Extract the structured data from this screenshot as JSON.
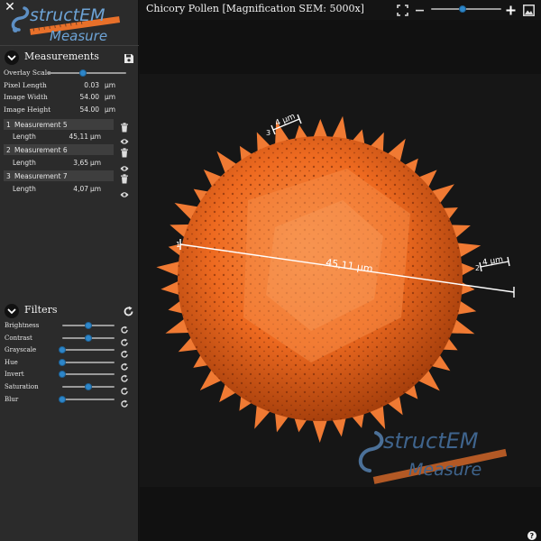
{
  "app": {
    "logo_top": "structEM",
    "logo_bottom": "Measure"
  },
  "image_title": "Chicory Pollen [Magnification SEM: 5000x]",
  "measurements_section": {
    "title": "Measurements",
    "overlay_scale": {
      "label": "Overlay Scale",
      "value": 0.45
    },
    "fields": [
      {
        "label": "Pixel Length",
        "value": "0.03",
        "unit": "µm"
      },
      {
        "label": "Image Width",
        "value": "54.00",
        "unit": "µm"
      },
      {
        "label": "Image Height",
        "value": "54.00",
        "unit": "µm"
      }
    ],
    "items": [
      {
        "index": "1",
        "name": "Measurement 5",
        "length_label": "Length",
        "value": "45,11",
        "unit": "µm"
      },
      {
        "index": "2",
        "name": "Measurement 6",
        "length_label": "Length",
        "value": "3,65",
        "unit": "µm"
      },
      {
        "index": "3",
        "name": "Measurement 7",
        "length_label": "Length",
        "value": "4,07",
        "unit": "µm"
      }
    ]
  },
  "filters_section": {
    "title": "Filters",
    "filters": [
      {
        "label": "Brightness",
        "value": 0.5
      },
      {
        "label": "Contrast",
        "value": 0.5
      },
      {
        "label": "Grayscale",
        "value": 0.0
      },
      {
        "label": "Hue",
        "value": 0.0
      },
      {
        "label": "Invert",
        "value": 0.0
      },
      {
        "label": "Saturation",
        "value": 0.5
      },
      {
        "label": "Blur",
        "value": 0.0
      }
    ]
  },
  "toolbar": {
    "zoom_value": 0.45
  },
  "overlay": {
    "measurement_main": {
      "index": "1",
      "label": "45,11 µm"
    },
    "measurement_top": {
      "index": "3",
      "label": "4 µm"
    },
    "measurement_right": {
      "index": "2",
      "label": "4 µm"
    }
  },
  "watermark": {
    "top": "structEM",
    "bottom": "Measure"
  },
  "colors": {
    "accent": "#2d86c9",
    "logo_orange": "#e8702a",
    "logo_blue": "#6da3d6",
    "pollen": "#ef6a22"
  }
}
